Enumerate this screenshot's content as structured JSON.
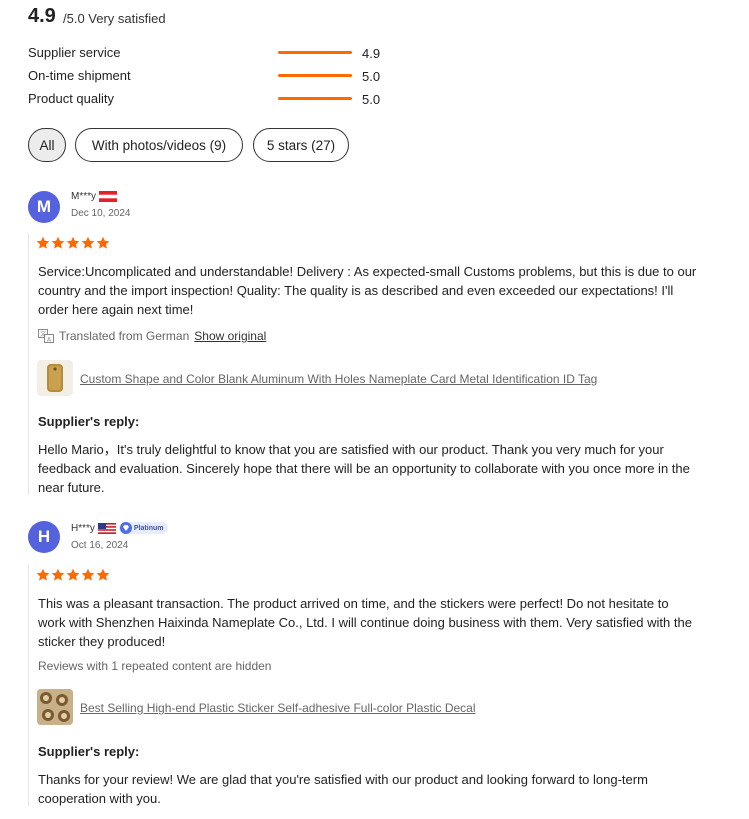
{
  "summary": {
    "score": "4.9",
    "score_suffix": "/5.0 Very satisfied",
    "metrics": [
      {
        "label": "Supplier service",
        "value": "4.9"
      },
      {
        "label": "On-time shipment",
        "value": "5.0"
      },
      {
        "label": "Product quality",
        "value": "5.0"
      }
    ],
    "accent_color": "#ff6a00"
  },
  "filters": [
    {
      "label": "All",
      "active": true
    },
    {
      "label": "With photos/videos (9)",
      "active": false
    },
    {
      "label": "5 stars (27)",
      "active": false
    }
  ],
  "reviews": [
    {
      "initial": "M",
      "user": "M***y",
      "flag": "austria-flag-icon",
      "date": "Dec 10, 2024",
      "rating": 5,
      "text": "Service:Uncomplicated and understandable! Delivery : As expected-small Customs problems, but this is due to our country and the import inspection! Quality: The quality is as described and even exceeded our expectations! I'll order here again next time!",
      "translated_from": "Translated from German",
      "show_original": "Show original",
      "product": "Custom Shape and Color Blank Aluminum With Holes Nameplate Card Metal Identification ID Tag",
      "reply_title": "Supplier's reply:",
      "reply": "Hello Mario，It's truly delightful to know that you are satisfied with our product. Thank you very much for your feedback and evaluation. Sincerely hope that there will be an opportunity to collaborate with you once more in the near future."
    },
    {
      "initial": "H",
      "user": "H***y",
      "flag": "usa-flag-icon",
      "badge": "Platinum",
      "date": "Oct 16, 2024",
      "rating": 5,
      "text": "This was a pleasant transaction. The product arrived on time, and the stickers were perfect! Do not hesitate to work with Shenzhen Haixinda Nameplate Co., Ltd. I will continue doing business with them. Very satisfied with the sticker they produced!",
      "hidden_note": "Reviews with 1 repeated content are hidden",
      "product": "Best Selling High-end Plastic Sticker Self-adhesive Full-color Plastic Decal",
      "reply_title": "Supplier's reply:",
      "reply": "Thanks for your review! We are glad that you're satisfied with our product and looking forward to long-term cooperation with you."
    }
  ]
}
